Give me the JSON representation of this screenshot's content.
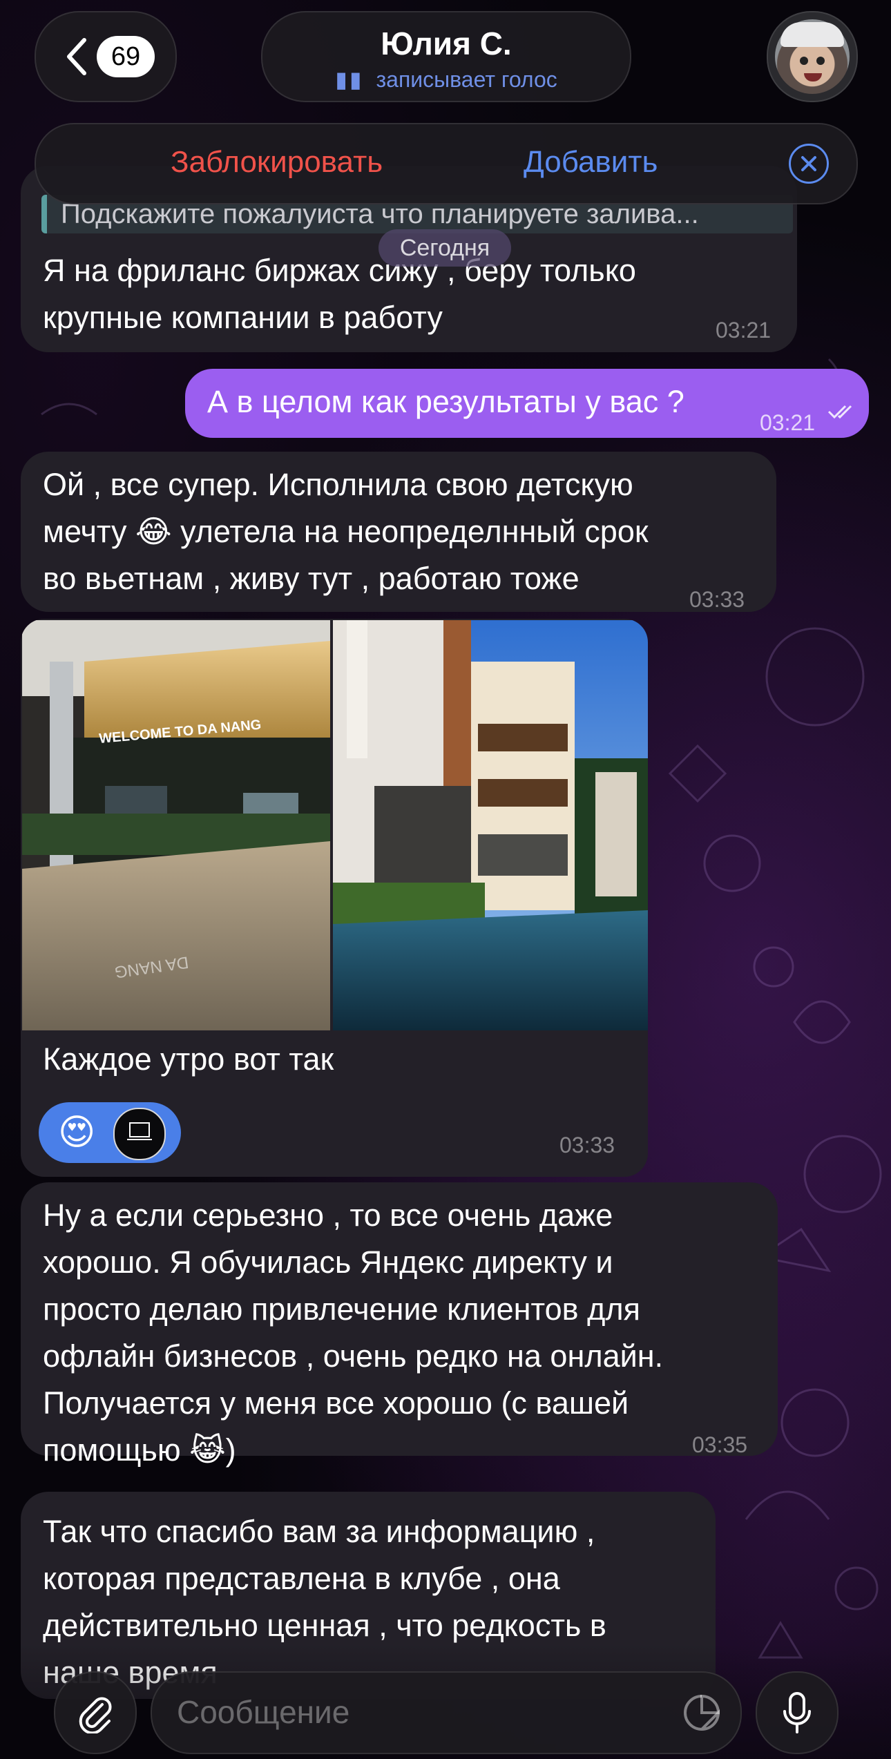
{
  "header": {
    "back_count": "69",
    "contact_name": "Юлия С.",
    "status": "записывает голос"
  },
  "action_bar": {
    "block_label": "Заблокировать",
    "add_label": "Добавить"
  },
  "reply": {
    "quote": "Подскажите пожалуиста что планируете залива..."
  },
  "date_chip": "Сегодня",
  "messages": [
    {
      "text": "Я на фриланс биржах сижу , беру только\nкрупные компании в работу",
      "time": "03:21"
    },
    {
      "text": "А в целом как результаты у вас ?",
      "time": "03:21"
    },
    {
      "text": "Ой , все супер. Исполнила свою детскую\nмечту 😂 улетела на неопределнный срок\nво вьетнам , живу тут , работаю тоже",
      "time": "03:33"
    },
    {
      "caption": "Каждое утро вот так",
      "time": "03:33",
      "photo_sign": "WELCOME TO DA NANG",
      "reaction": "😍"
    },
    {
      "text": "Ну а если серьезно , то все очень даже\nхорошо. Я обучилась Яндекс директу и\nпросто делаю привлечение клиентов для\nофлайн бизнесов , очень редко на онлайн.\nПолучается у меня все хорошо (с вашей\nпомощью 😹)",
      "time": "03:35"
    },
    {
      "text": "Так что спасибо вам за информацию ,\nкоторая представлена в клубе , она\nдействительно ценная , что редкость в\nнаше время"
    }
  ],
  "composer": {
    "placeholder": "Сообщение"
  },
  "colors": {
    "incoming_bubble": "#232028",
    "outgoing_bubble": "#9b5ef0",
    "accent_blue": "#5b8bef",
    "destructive_red": "#f0524a"
  }
}
